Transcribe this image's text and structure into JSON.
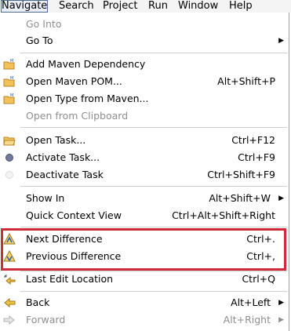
{
  "menubar": {
    "items": [
      {
        "label": "Navigate"
      },
      {
        "label": "Search"
      },
      {
        "label": "Project"
      },
      {
        "label": "Run"
      },
      {
        "label": "Window"
      },
      {
        "label": "Help"
      }
    ]
  },
  "menu": {
    "go_into": "Go Into",
    "go_to": "Go To",
    "add_maven_dependency": "Add Maven Dependency",
    "open_maven_pom": "Open Maven POM...",
    "open_maven_pom_shortcut": "Alt+Shift+P",
    "open_type_from_maven": "Open Type from Maven...",
    "open_from_clipboard": "Open from Clipboard",
    "open_task": "Open Task...",
    "open_task_shortcut": "Ctrl+F12",
    "activate_task": "Activate Task...",
    "activate_task_shortcut": "Ctrl+F9",
    "deactivate_task": "Deactivate Task",
    "deactivate_task_shortcut": "Ctrl+Shift+F9",
    "show_in": "Show In",
    "show_in_shortcut": "Alt+Shift+W",
    "quick_context_view": "Quick Context View",
    "quick_context_view_shortcut": "Ctrl+Alt+Shift+Right",
    "next_difference": "Next Difference",
    "next_difference_shortcut": "Ctrl+.",
    "previous_difference": "Previous Difference",
    "previous_difference_shortcut": "Ctrl+,",
    "last_edit_location": "Last Edit Location",
    "last_edit_location_shortcut": "Ctrl+Q",
    "back": "Back",
    "back_shortcut": "Alt+Left",
    "forward": "Forward",
    "forward_shortcut": "Alt+Right"
  },
  "colors": {
    "highlight_border": "#cf2a3a",
    "disabled_text": "#8f8f8f",
    "folder_icon": "#e0a52a"
  }
}
